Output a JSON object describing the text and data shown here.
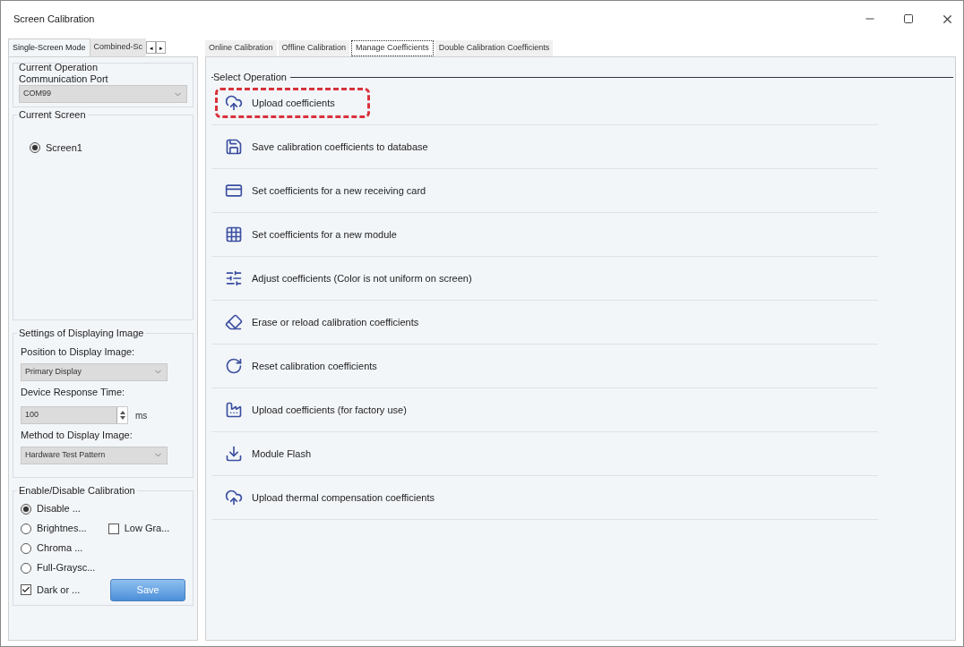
{
  "window": {
    "title": "Screen Calibration"
  },
  "left_tabs": [
    {
      "label": "Single-Screen Mode",
      "selected": true
    },
    {
      "label": "Combined-Sc",
      "selected": false
    }
  ],
  "tab_scroll": [
    "◂",
    "▸"
  ],
  "operation": {
    "title": "Current Operation",
    "port_label": "Communication Port",
    "port_value": "COM99"
  },
  "current_screen": {
    "title": "Current Screen",
    "screens": [
      {
        "label": "Screen1",
        "selected": true
      }
    ]
  },
  "display_settings": {
    "title": "Settings of Displaying Image",
    "position_label": "Position to Display Image:",
    "position_value": "Primary Display",
    "response_label": "Device Response Time:",
    "response_value": "100",
    "response_unit": "ms",
    "method_label": "Method to Display Image:",
    "method_value": "Hardware Test Pattern"
  },
  "calibration": {
    "title": "Enable/Disable Calibration",
    "options": [
      {
        "label": "Disable ...",
        "selected": true
      },
      {
        "label": "Brightnes...",
        "selected": false
      },
      {
        "label": "Chroma ...",
        "selected": false
      },
      {
        "label": "Full-Graysc...",
        "selected": false
      }
    ],
    "low_gray": {
      "label": "Low Gra...",
      "checked": false
    },
    "dark": {
      "label": "Dark or ...",
      "checked": true
    },
    "save_button": "Save"
  },
  "right_tabs": [
    {
      "label": "Online Calibration",
      "selected": false
    },
    {
      "label": "Offline Calibration",
      "selected": false
    },
    {
      "label": "Manage Coefficients",
      "selected": true
    },
    {
      "label": "Double Calibration Coefficients",
      "selected": false
    }
  ],
  "select_operation": {
    "title": "Select Operation",
    "items": [
      {
        "label": "Upload coefficients",
        "highlighted": true
      },
      {
        "label": "Save calibration coefficients to database",
        "highlighted": false
      },
      {
        "label": "Set coefficients for a new receiving card",
        "highlighted": false
      },
      {
        "label": "Set coefficients for a new module",
        "highlighted": false
      },
      {
        "label": "Adjust coefficients (Color is not uniform on screen)",
        "highlighted": false
      },
      {
        "label": "Erase or reload calibration coefficients",
        "highlighted": false
      },
      {
        "label": "Reset calibration coefficients",
        "highlighted": false
      },
      {
        "label": "Upload coefficients (for factory use)",
        "highlighted": false
      },
      {
        "label": "Module Flash",
        "highlighted": false
      },
      {
        "label": "Upload thermal compensation coefficients",
        "highlighted": false
      }
    ]
  }
}
